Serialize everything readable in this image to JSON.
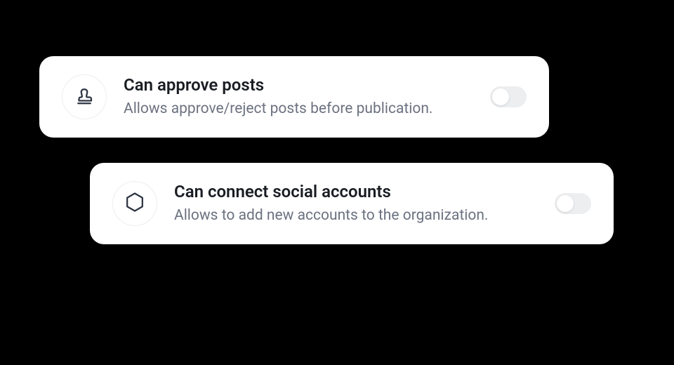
{
  "permissions": [
    {
      "icon": "stamp",
      "title": "Can approve posts",
      "description": "Allows approve/reject posts before publication.",
      "enabled": false
    },
    {
      "icon": "hexagon",
      "title": "Can connect social accounts",
      "description": "Allows to add new accounts to the organization.",
      "enabled": false
    }
  ]
}
